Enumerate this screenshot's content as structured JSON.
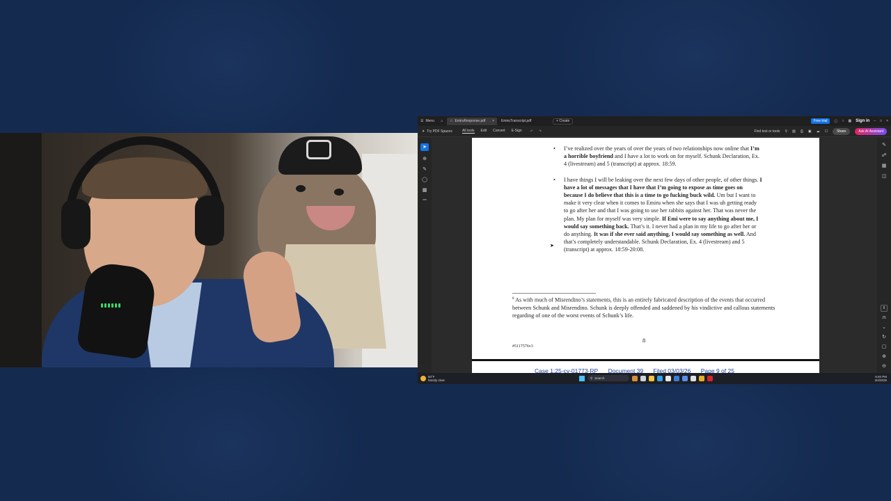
{
  "webcam": {
    "scene": "host"
  },
  "acrobat": {
    "menu_label": "Menu",
    "tabs": [
      {
        "label": "EmiruResponse.pdf",
        "active": true
      },
      {
        "label": "EmiruTranscript.pdf",
        "active": false
      }
    ],
    "create_label": "Create",
    "free_trial_label": "Free trial",
    "sign_in_label": "Sign in",
    "toolbar": {
      "spaces_label": "Try PDF Spaces",
      "tools": [
        "All tools",
        "Edit",
        "Convert",
        "E-Sign"
      ],
      "find_label": "Find text or tools",
      "share_label": "Share",
      "ai_label": "Ask AI Assistant"
    },
    "page_indicator": "8",
    "page_total": "25"
  },
  "document": {
    "bullet1": {
      "t1": "I’ve realized over the years of over the years of two relationships now online that ",
      "b1": "I’m a horrible boyfriend",
      "t2": " and I have a lot to work on for myself.  Schunk Declaration, Ex. 4 (livestream) and 5 (transcript) at approx. 18:59."
    },
    "bullet2": {
      "t1": "I have things I will be leaking over the next few days of other people, of other things. ",
      "b1": "I have a lot of messages that I have that I’m going to expose as time goes on because I do believe that this is a time to go fucking buck wild.",
      "t2": " Um but I want to make it very clear when it comes to Emiru when she says that I was uh getting ready to go after her and that I was going to use her rabbits against her. That was never the plan. My plan for myself was very simple. ",
      "b2": "If Emi were to say anything about me, I would say something back.",
      "t3": " That’s it. I never had a plan in my life to go after her or do anything. ",
      "b3": "It was if she ever said anything, I would say something as well.",
      "t4": " And that’s completely understandable.  Schunk Declaration, Ex. 4 (livestream) and 5 (transcript) at approx. 18:59-20:08."
    },
    "footnote_num": "8",
    "footnote_text": " As with much of Misrendino’s statements, this is an entirely fabricated description of the events that occurred between Schunk and Misrendino.  Schunk is deeply offended and saddened by his vindictive and callous statements regarding of one of the worst events of Schunk’s life.",
    "page_number": "8",
    "doc_id": "#5117576v3",
    "next_page_header": [
      "Case 1:25-cv-01773-RP",
      "Document 39",
      "Filed 03/03/26",
      "Page 9 of 25"
    ]
  },
  "taskbar": {
    "weather_temp": "84°F",
    "weather_desc": "Mostly clear",
    "search_label": "Search",
    "time": "9:40 PM",
    "date": "3/4/2026"
  },
  "colors": {
    "background": "#142a4f",
    "accent_blue": "#1473e6",
    "acrobat_red": "#e0245e",
    "link_blue": "#1c3c9c"
  }
}
